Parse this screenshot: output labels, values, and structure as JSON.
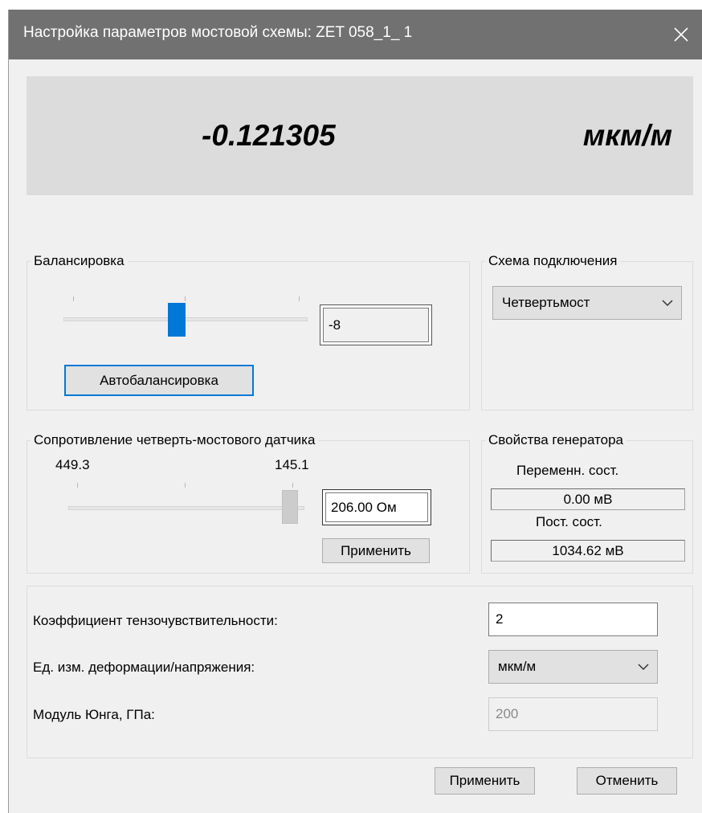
{
  "window": {
    "title": "Настройка параметров мостовой схемы: ZET 058_1_ 1"
  },
  "display": {
    "value": "-0.121305",
    "unit": "мкм/м"
  },
  "balance": {
    "legend": "Балансировка",
    "value": "-8",
    "auto_button": "Автобалансировка"
  },
  "scheme": {
    "legend": "Схема подключения",
    "selected": "Четвертьмост"
  },
  "resistance": {
    "legend": "Сопротивление четверть-мостового датчика",
    "min_label": "449.3",
    "max_label": "145.1",
    "value": "206.00 Ом",
    "apply_button": "Применить"
  },
  "generator": {
    "legend": "Свойства генератора",
    "ac_label": "Переменн. сост.",
    "ac_value": "0.00 мВ",
    "dc_label": "Пост. сост.",
    "dc_value": "1034.62 мВ"
  },
  "params": {
    "gauge_factor_label": "Коэффициент тензочувствительности:",
    "gauge_factor_value": "2",
    "unit_label": "Ед. изм. деформации/напряжения:",
    "unit_selected": "мкм/м",
    "young_label": "Модуль Юнга, ГПа:",
    "young_value": "200"
  },
  "footer": {
    "apply": "Применить",
    "cancel": "Отменить"
  },
  "colors": {
    "titlebar": "#717171",
    "accent": "#0078d7",
    "display_bg": "#dcdcdc"
  }
}
